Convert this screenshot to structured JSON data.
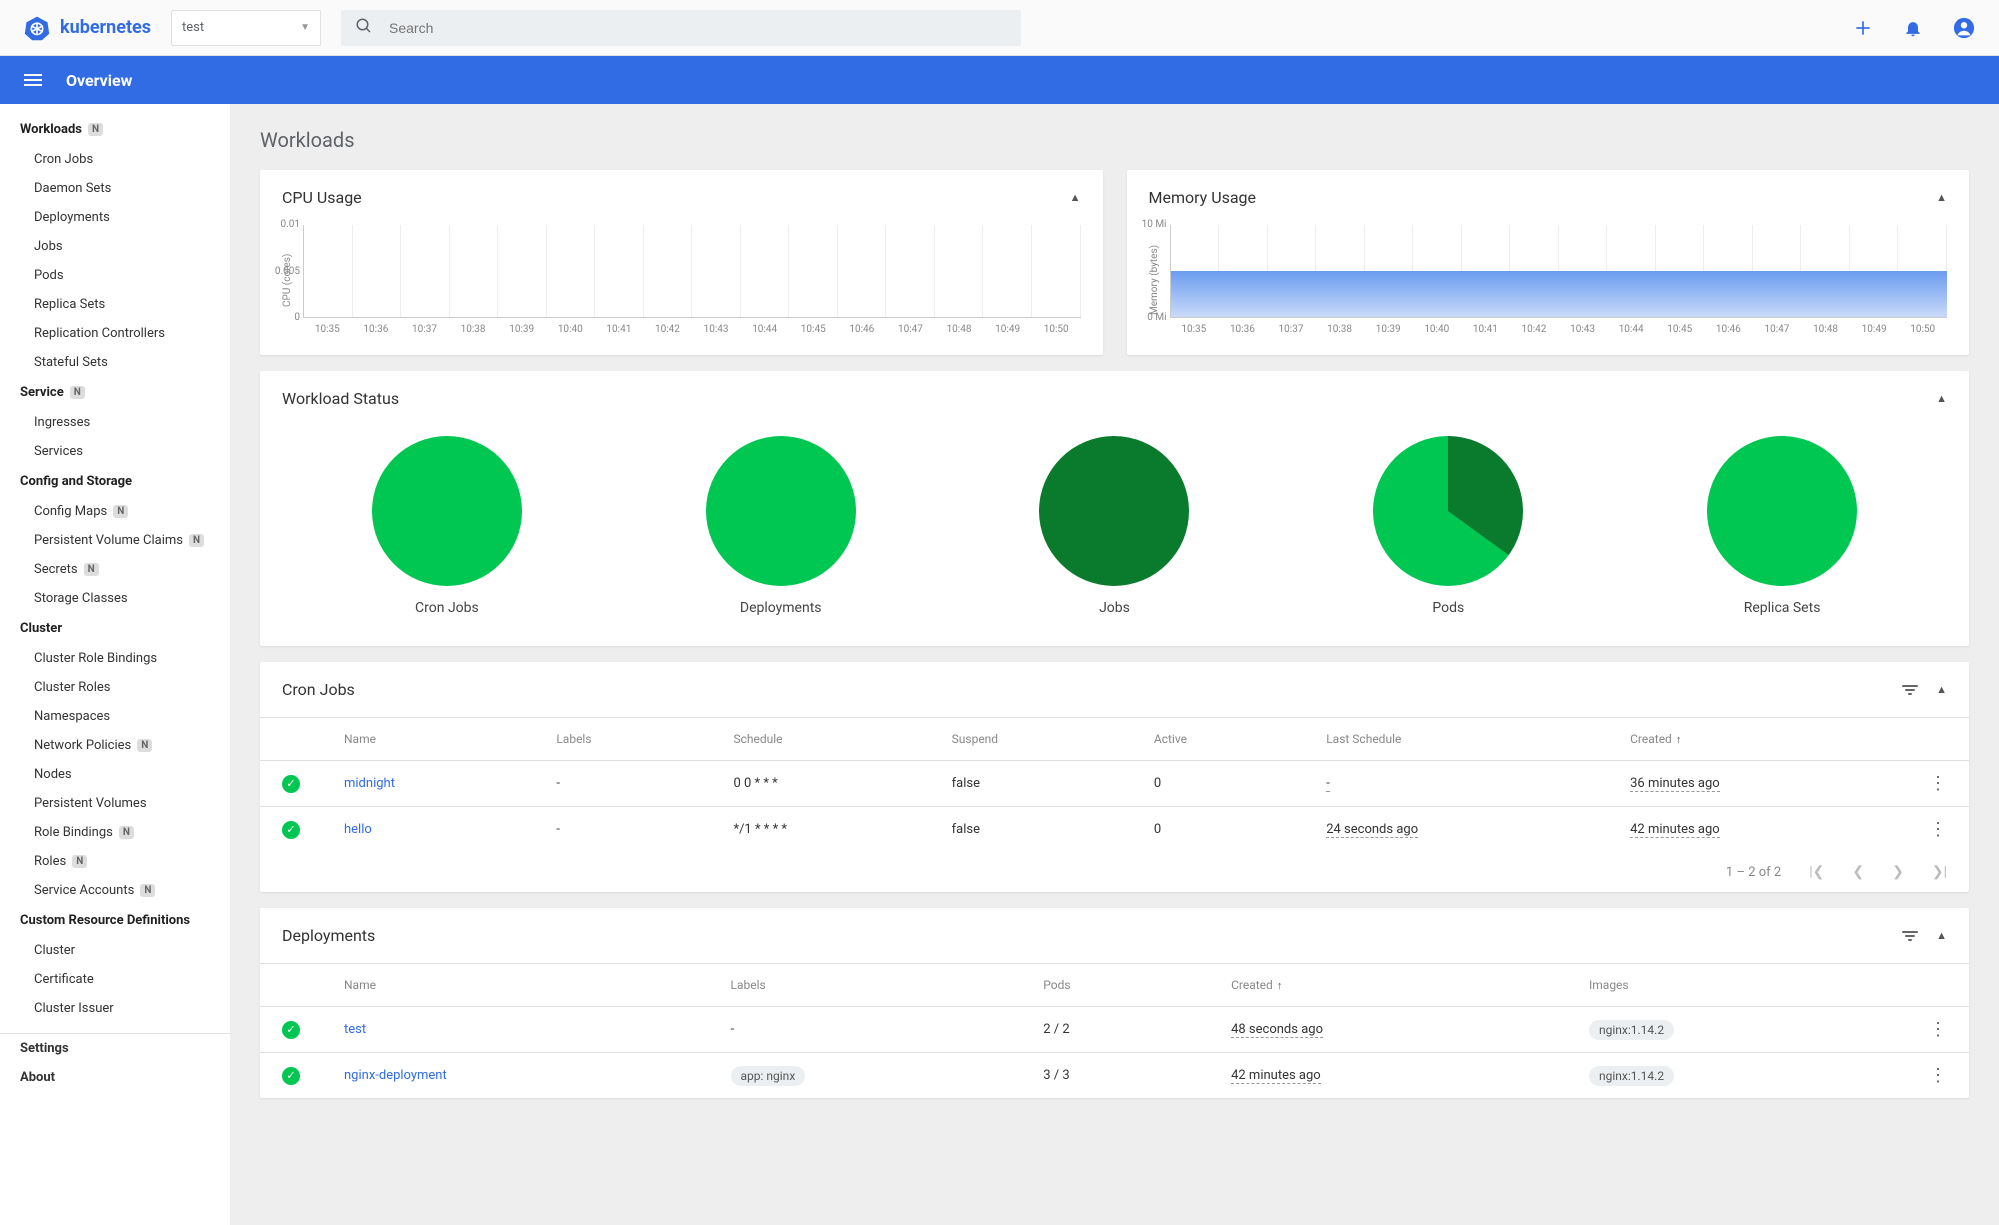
{
  "brand": "kubernetes",
  "namespace_selected": "test",
  "search": {
    "placeholder": "Search"
  },
  "page_header": "Overview",
  "page_title": "Workloads",
  "sidebar": {
    "groups": [
      {
        "title": "Workloads",
        "badge": "N",
        "items": [
          {
            "label": "Cron Jobs"
          },
          {
            "label": "Daemon Sets"
          },
          {
            "label": "Deployments"
          },
          {
            "label": "Jobs"
          },
          {
            "label": "Pods"
          },
          {
            "label": "Replica Sets"
          },
          {
            "label": "Replication Controllers"
          },
          {
            "label": "Stateful Sets"
          }
        ]
      },
      {
        "title": "Service",
        "badge": "N",
        "items": [
          {
            "label": "Ingresses"
          },
          {
            "label": "Services"
          }
        ]
      },
      {
        "title": "Config and Storage",
        "badge": "",
        "items": [
          {
            "label": "Config Maps",
            "badge": "N"
          },
          {
            "label": "Persistent Volume Claims",
            "badge": "N"
          },
          {
            "label": "Secrets",
            "badge": "N"
          },
          {
            "label": "Storage Classes"
          }
        ]
      },
      {
        "title": "Cluster",
        "badge": "",
        "items": [
          {
            "label": "Cluster Role Bindings"
          },
          {
            "label": "Cluster Roles"
          },
          {
            "label": "Namespaces"
          },
          {
            "label": "Network Policies",
            "badge": "N"
          },
          {
            "label": "Nodes"
          },
          {
            "label": "Persistent Volumes"
          },
          {
            "label": "Role Bindings",
            "badge": "N"
          },
          {
            "label": "Roles",
            "badge": "N"
          },
          {
            "label": "Service Accounts",
            "badge": "N"
          }
        ]
      },
      {
        "title": "Custom Resource Definitions",
        "badge": "",
        "items": [
          {
            "label": "Cluster"
          },
          {
            "label": "Certificate"
          },
          {
            "label": "Cluster Issuer"
          }
        ]
      }
    ],
    "footer": [
      {
        "label": "Settings"
      },
      {
        "label": "About"
      }
    ]
  },
  "chart_data": [
    {
      "type": "area",
      "title": "CPU Usage",
      "ylabel": "CPU (cores)",
      "x": [
        "10:35",
        "10:36",
        "10:37",
        "10:38",
        "10:39",
        "10:40",
        "10:41",
        "10:42",
        "10:43",
        "10:44",
        "10:45",
        "10:46",
        "10:47",
        "10:48",
        "10:49",
        "10:50"
      ],
      "series": [
        {
          "name": "cpu",
          "values": [
            0,
            0,
            0,
            0,
            0,
            0,
            0,
            0,
            0,
            0,
            0,
            0,
            0,
            0,
            0,
            0
          ]
        }
      ],
      "yticks": [
        "0.01",
        "0.005",
        "0"
      ],
      "ylim": [
        0,
        0.01
      ]
    },
    {
      "type": "area",
      "title": "Memory Usage",
      "ylabel": "Memory (bytes)",
      "x": [
        "10:35",
        "10:36",
        "10:37",
        "10:38",
        "10:39",
        "10:40",
        "10:41",
        "10:42",
        "10:43",
        "10:44",
        "10:45",
        "10:46",
        "10:47",
        "10:48",
        "10:49",
        "10:50"
      ],
      "series": [
        {
          "name": "memory_mi",
          "values": [
            10,
            10,
            10,
            10,
            10,
            10,
            10,
            10,
            10,
            10,
            10,
            10,
            10,
            10,
            10,
            10
          ]
        }
      ],
      "yticks": [
        "10 Mi",
        "0 Mi"
      ],
      "ylim": [
        0,
        20
      ]
    }
  ],
  "workload_status": {
    "title": "Workload Status",
    "items": [
      {
        "label": "Cron Jobs",
        "slices": [
          {
            "color": "#00c752",
            "pct": 100
          }
        ]
      },
      {
        "label": "Deployments",
        "slices": [
          {
            "color": "#00c752",
            "pct": 100
          }
        ]
      },
      {
        "label": "Jobs",
        "slices": [
          {
            "color": "#0a7b2d",
            "pct": 100
          }
        ]
      },
      {
        "label": "Pods",
        "slices": [
          {
            "color": "#0a7b2d",
            "pct": 35
          },
          {
            "color": "#00c752",
            "pct": 65
          }
        ]
      },
      {
        "label": "Replica Sets",
        "slices": [
          {
            "color": "#00c752",
            "pct": 100
          }
        ]
      }
    ]
  },
  "cronjobs": {
    "title": "Cron Jobs",
    "columns": [
      "Name",
      "Labels",
      "Schedule",
      "Suspend",
      "Active",
      "Last Schedule",
      "Created"
    ],
    "sort_col": "Created",
    "sort_dir": "asc",
    "rows": [
      {
        "name": "midnight",
        "labels": "-",
        "schedule": "0 0 * * *",
        "suspend": "false",
        "active": "0",
        "last": "-",
        "created": "36 minutes ago"
      },
      {
        "name": "hello",
        "labels": "-",
        "schedule": "*/1 * * * *",
        "suspend": "false",
        "active": "0",
        "last": "24 seconds ago",
        "created": "42 minutes ago"
      }
    ],
    "pager": "1 – 2 of 2"
  },
  "deployments": {
    "title": "Deployments",
    "columns": [
      "Name",
      "Labels",
      "Pods",
      "Created",
      "Images"
    ],
    "sort_col": "Created",
    "sort_dir": "asc",
    "rows": [
      {
        "name": "test",
        "labels": "-",
        "pods": "2 / 2",
        "created": "48 seconds ago",
        "images": "nginx:1.14.2"
      },
      {
        "name": "nginx-deployment",
        "labels": "app: nginx",
        "pods": "3 / 3",
        "created": "42 minutes ago",
        "images": "nginx:1.14.2"
      }
    ]
  }
}
